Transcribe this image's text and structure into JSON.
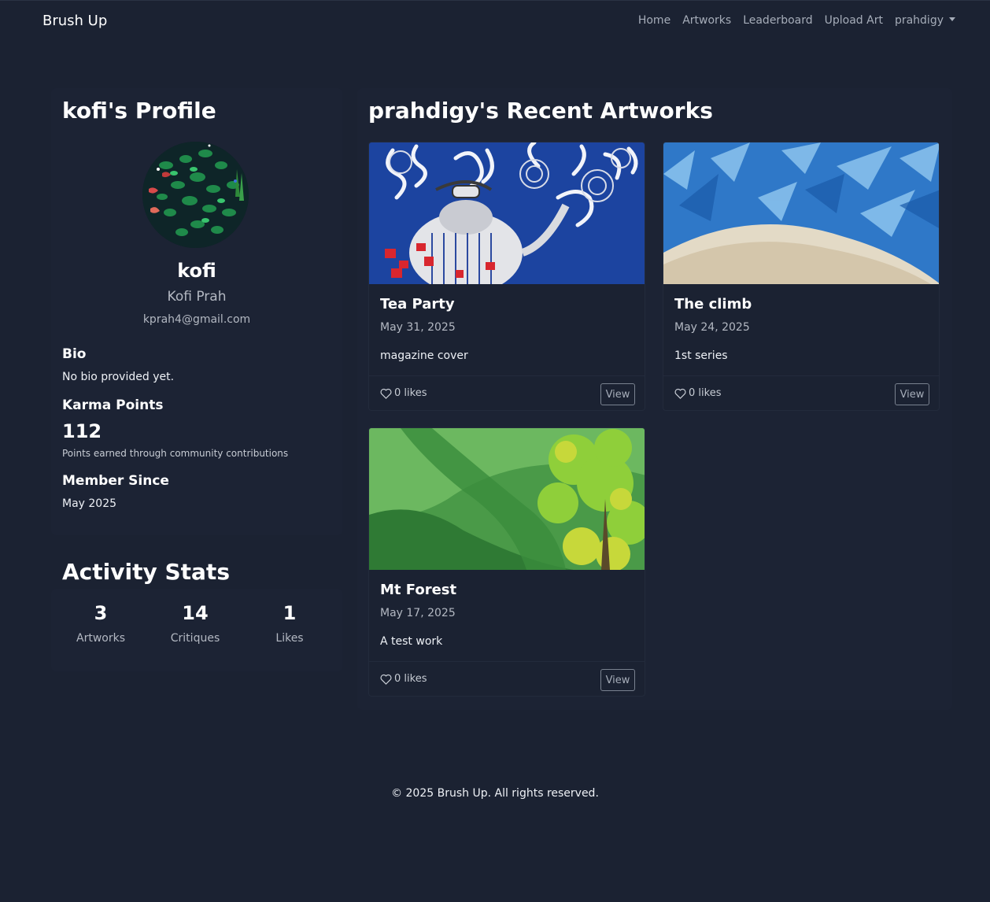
{
  "nav": {
    "brand": "Brush Up",
    "links": [
      "Home",
      "Artworks",
      "Leaderboard",
      "Upload Art"
    ],
    "user_menu": "prahdigy"
  },
  "profile": {
    "heading": "kofi's Profile",
    "username": "kofi",
    "full_name": "Kofi Prah",
    "email": "kprah4@gmail.com",
    "bio_title": "Bio",
    "bio_text": "No bio provided yet.",
    "karma_title": "Karma Points",
    "karma_value": "112",
    "karma_note": "Points earned through community contributions",
    "member_title": "Member Since",
    "member_value": "May 2025"
  },
  "activity": {
    "heading": "Activity Stats",
    "stats": [
      {
        "value": "3",
        "label": "Artworks"
      },
      {
        "value": "14",
        "label": "Critiques"
      },
      {
        "value": "1",
        "label": "Likes"
      }
    ]
  },
  "artworks": {
    "heading": "prahdigy's Recent Artworks",
    "items": [
      {
        "title": "Tea Party",
        "date": "May 31, 2025",
        "description": "magazine cover",
        "likes": "0 likes",
        "view_label": "View"
      },
      {
        "title": "The climb",
        "date": "May 24, 2025",
        "description": "1st series",
        "likes": "0 likes",
        "view_label": "View"
      },
      {
        "title": "Mt Forest",
        "date": "May 17, 2025",
        "description": "A test work",
        "likes": "0 likes",
        "view_label": "View"
      }
    ]
  },
  "footer": {
    "text": "© 2025 Brush Up. All rights reserved."
  },
  "colors": {
    "background": "#1b2232",
    "text": "#eef1f6",
    "muted": "#b3b8c2"
  }
}
